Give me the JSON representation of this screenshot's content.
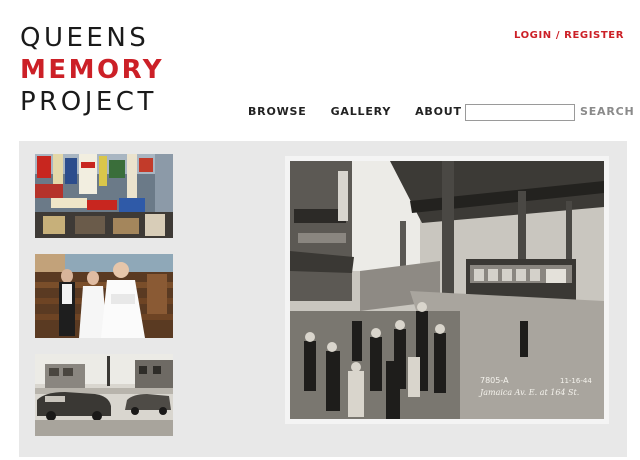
{
  "site": {
    "logo_line1": "QUEENS",
    "logo_line2": "MEMORY",
    "logo_line3": "PROJECT",
    "brand_color": "#cc2027"
  },
  "header": {
    "auth_link": "LOGIN / REGISTER"
  },
  "nav": {
    "items": [
      {
        "label": "BROWSE"
      },
      {
        "label": "GALLERY"
      },
      {
        "label": "ABOUT"
      }
    ]
  },
  "search": {
    "placeholder": "",
    "button_label": "SEARCH"
  },
  "gallery": {
    "thumbnails": [
      {
        "subject": "street-storefront-signs"
      },
      {
        "subject": "women-in-white-dresses-church"
      },
      {
        "subject": "street-with-vintage-cars"
      }
    ],
    "feature": {
      "caption_line1": "7805-A",
      "caption_date": "11-16-44",
      "caption_line2": "Jamaica Av. E. at 164 St."
    }
  }
}
